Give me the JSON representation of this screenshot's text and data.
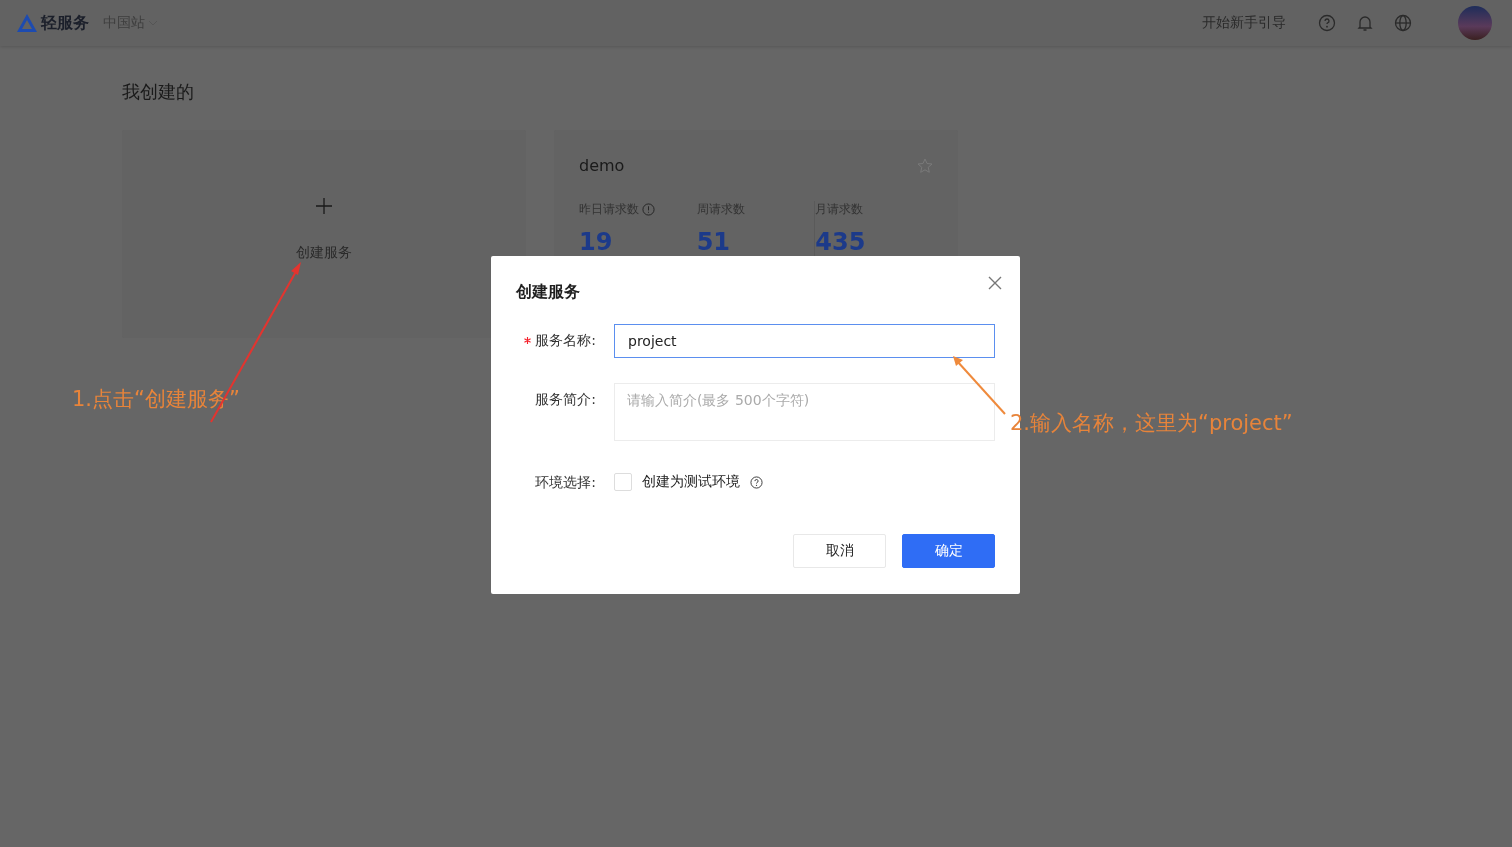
{
  "header": {
    "logo_text": "轻服务",
    "region": "中国站",
    "guide_link": "开始新手引导"
  },
  "section_title": "我创建的",
  "create_card": {
    "label": "创建服务"
  },
  "services": [
    {
      "name": "demo",
      "starred": false,
      "stats": [
        {
          "label": "昨日请求数",
          "info": true,
          "value": "19"
        },
        {
          "label": "周请求数",
          "info": false,
          "value": "51"
        },
        {
          "label": "月请求数",
          "info": false,
          "value": "435"
        }
      ]
    }
  ],
  "dialog": {
    "title": "创建服务",
    "fields": [
      {
        "kind": "text",
        "label": "服务名称:",
        "required": true,
        "value": "project"
      },
      {
        "kind": "textarea",
        "label": "服务简介:",
        "required": false,
        "placeholder": "请输入简介(最多 500个字符)"
      },
      {
        "kind": "checkbox",
        "label": "环境选择:",
        "required": false,
        "option": "创建为测试环境",
        "checked": false,
        "help": true
      }
    ],
    "buttons": [
      {
        "label": "取消",
        "primary": false
      },
      {
        "label": "确定",
        "primary": true
      }
    ]
  },
  "annotations": [
    {
      "text": "1.点击“创建服务”"
    },
    {
      "text": "2.输入名称，这里为“project”"
    }
  ]
}
